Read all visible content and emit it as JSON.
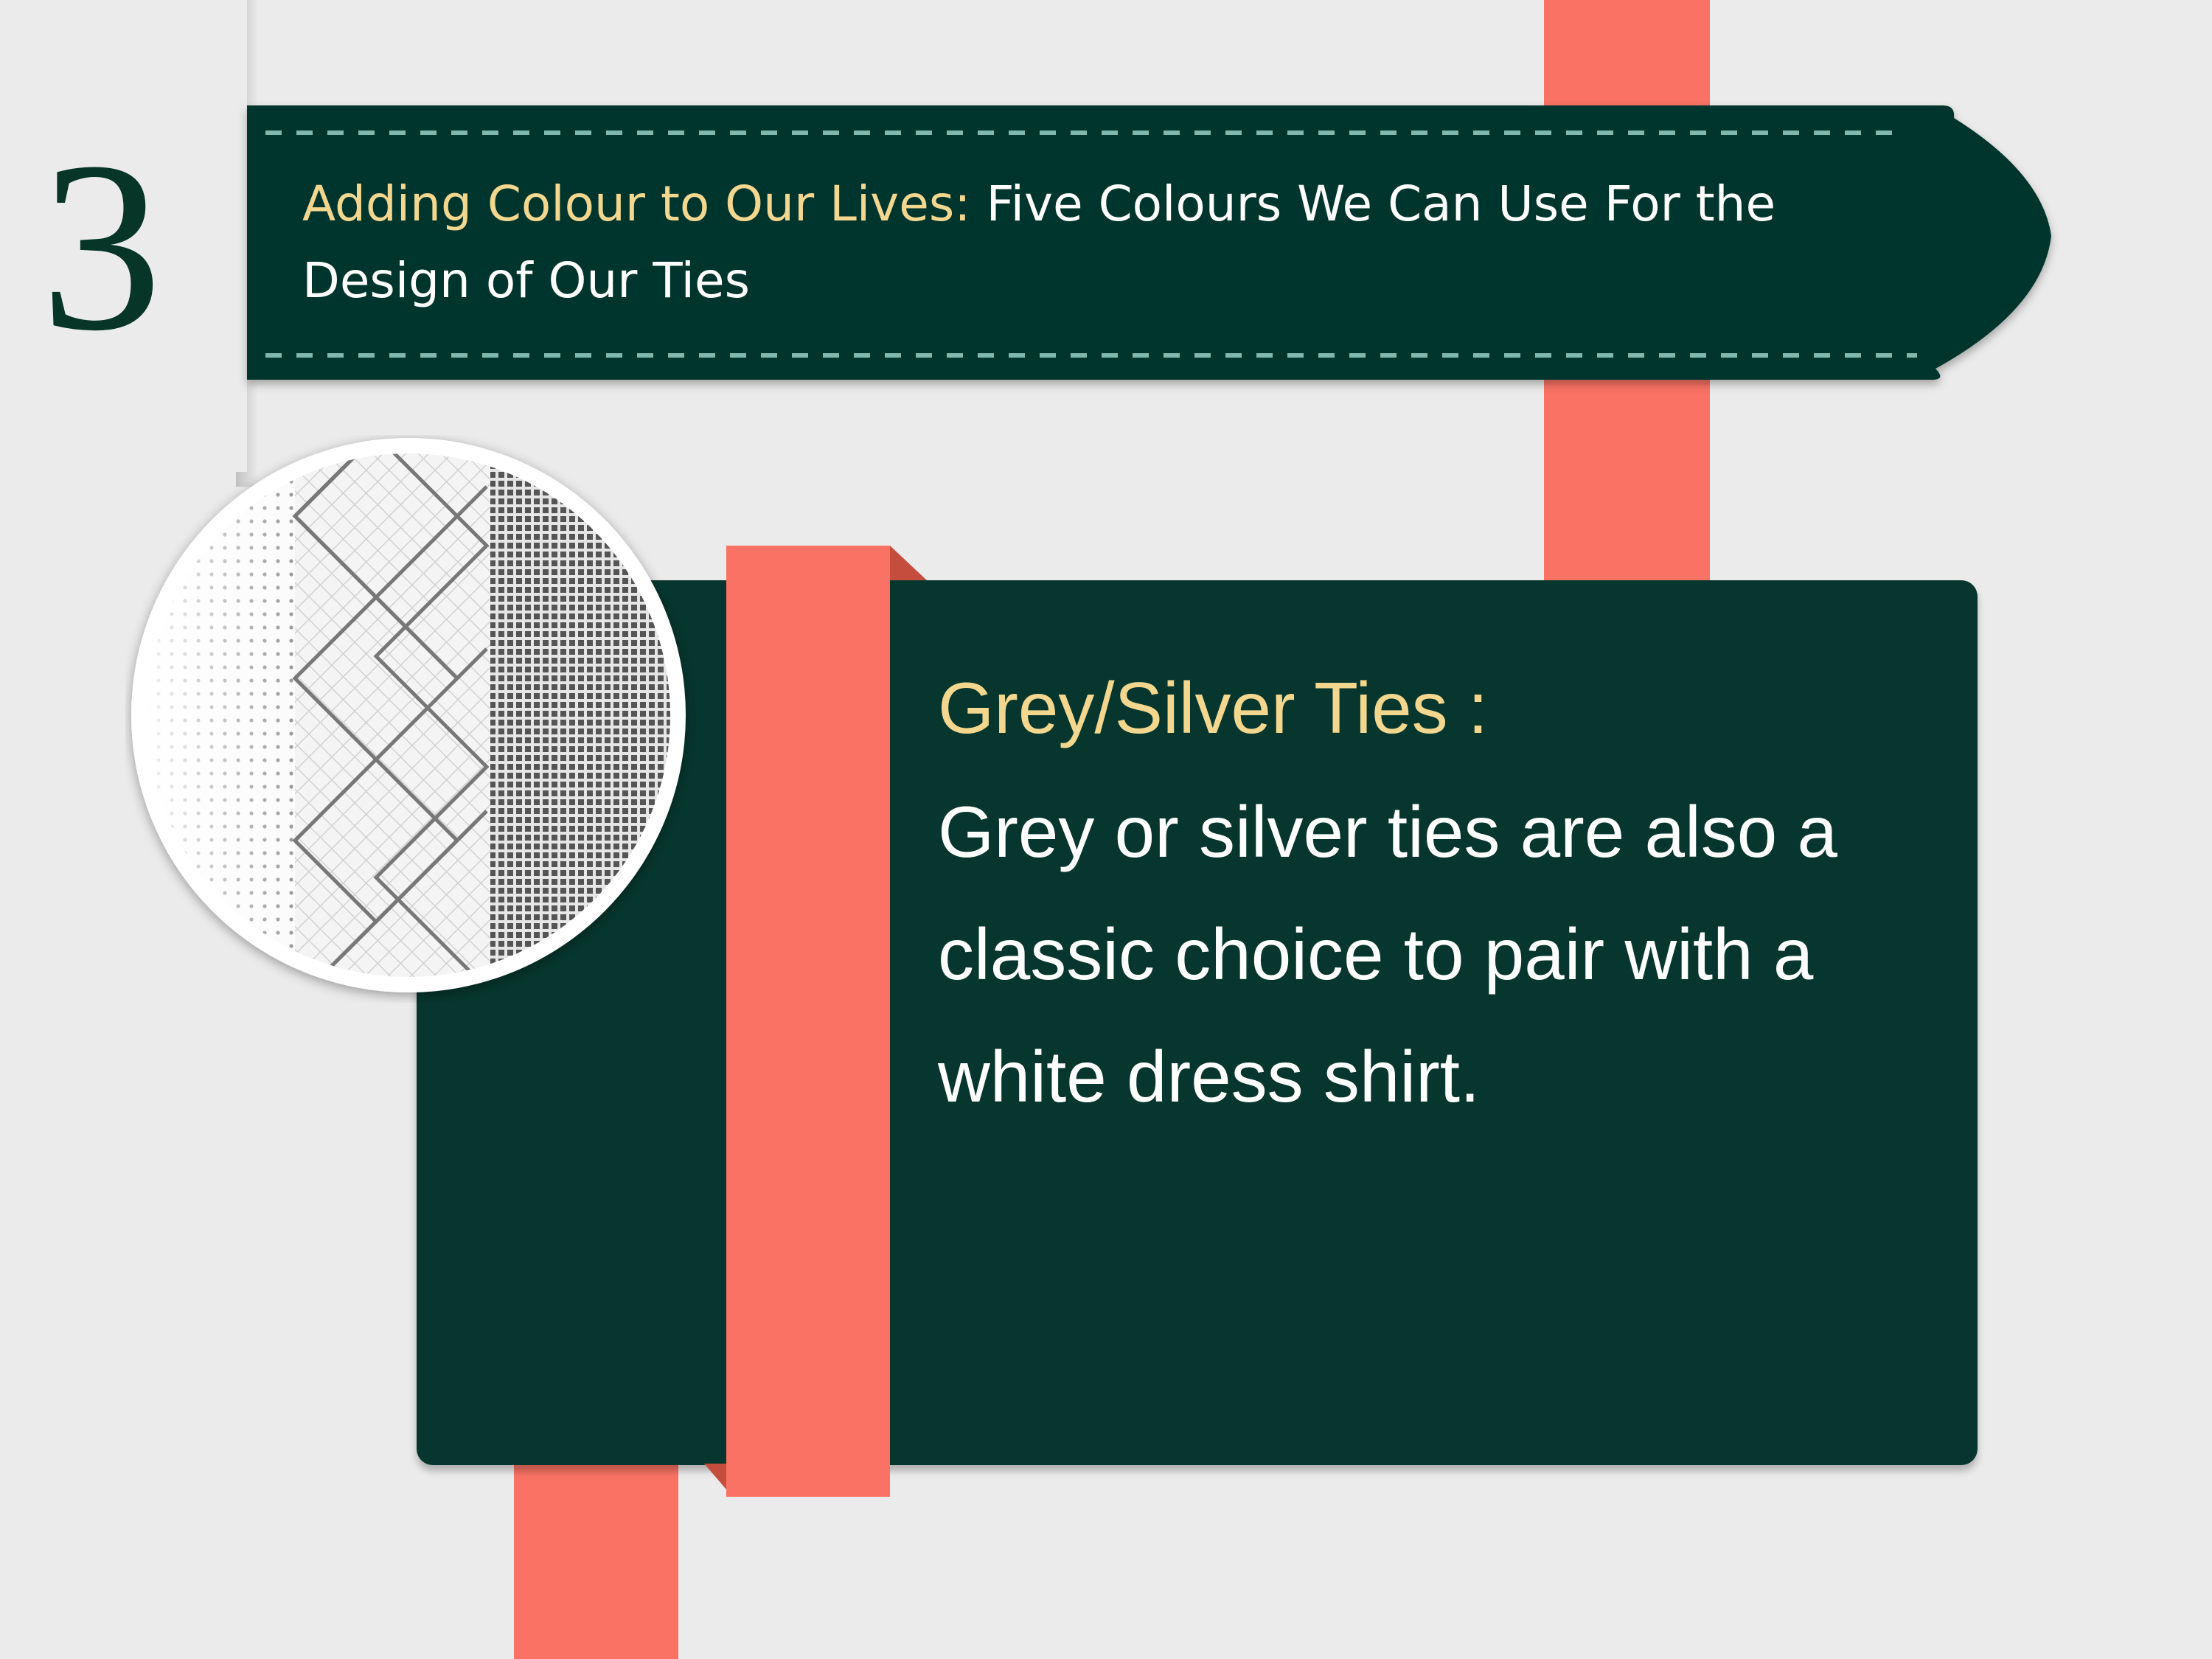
{
  "section_number": "3",
  "header": {
    "accent_text": "Adding Colour to Our Lives:",
    "line1_rest": " Five Colours We Can Use For the",
    "line2": "Design of Our Ties"
  },
  "card": {
    "title": "Grey/Silver Ties :",
    "body": "Grey or silver ties are also a classic choice to pair with a white dress shirt."
  },
  "colors": {
    "dark_green": "#06362d",
    "coral": "#f97264",
    "gold_accent": "#f3d78e",
    "background": "#ebebeb"
  },
  "icons": {
    "magnifier": "magnified-tie-texture-icon"
  }
}
